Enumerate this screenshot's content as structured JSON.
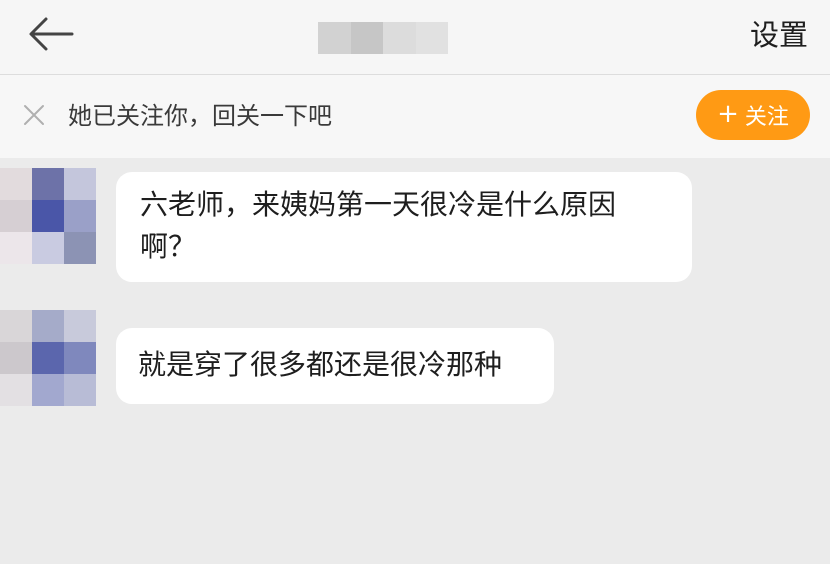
{
  "header": {
    "back_icon": "arrow-left-icon",
    "settings_label": "设置"
  },
  "follow_banner": {
    "close_icon": "close-icon",
    "text": "她已关注你，回关一下吧",
    "button_plus": "+",
    "button_label": "关注",
    "button_color": "#ff9a14"
  },
  "messages": [
    {
      "text": "六老师，来姨妈第一天很冷是什么原因啊？"
    },
    {
      "text": "就是穿了很多都还是很冷那种"
    }
  ]
}
